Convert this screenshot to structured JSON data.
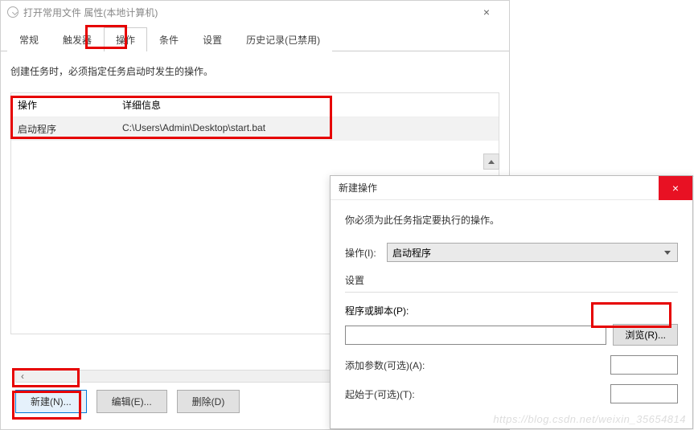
{
  "window": {
    "title": "打开常用文件 属性(本地计算机)",
    "close_glyph": "×"
  },
  "tabs": {
    "general": "常规",
    "triggers": "触发器",
    "actions": "操作",
    "conditions": "条件",
    "settings": "设置",
    "history": "历史记录(已禁用)"
  },
  "content": {
    "description": "创建任务时，必须指定任务启动时发生的操作。"
  },
  "table": {
    "col_action": "操作",
    "col_detail": "详细信息",
    "row1_action": "启动程序",
    "row1_detail": "C:\\Users\\Admin\\Desktop\\start.bat"
  },
  "buttons": {
    "new": "新建(N)...",
    "edit": "编辑(E)...",
    "delete": "删除(D)"
  },
  "scroll": {
    "left_glyph": "‹",
    "right_glyph": "›"
  },
  "dialog": {
    "title": "新建操作",
    "close_glyph": "×",
    "description": "你必须为此任务指定要执行的操作。",
    "action_label": "操作(I):",
    "action_value": "启动程序",
    "settings_label": "设置",
    "program_label": "程序或脚本(P):",
    "browse_btn": "浏览(R)...",
    "args_label": "添加参数(可选)(A):",
    "startin_label": "起始于(可选)(T):"
  },
  "watermark": "https://blog.csdn.net/weixin_35654814"
}
